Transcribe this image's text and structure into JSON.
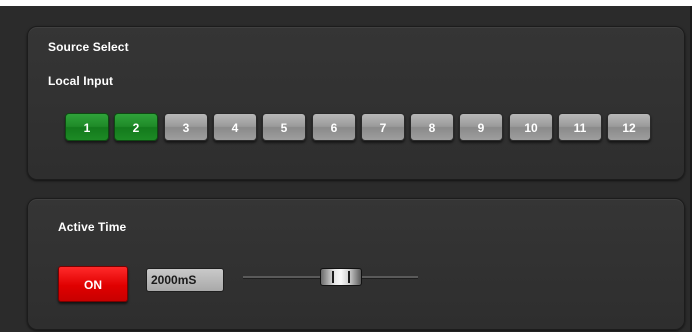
{
  "source_select": {
    "title": "Source Select",
    "local_input_label": "Local Input",
    "channels": [
      {
        "label": "1",
        "active": true
      },
      {
        "label": "2",
        "active": true
      },
      {
        "label": "3",
        "active": false
      },
      {
        "label": "4",
        "active": false
      },
      {
        "label": "5",
        "active": false
      },
      {
        "label": "6",
        "active": false
      },
      {
        "label": "7",
        "active": false
      },
      {
        "label": "8",
        "active": false
      },
      {
        "label": "9",
        "active": false
      },
      {
        "label": "10",
        "active": false
      },
      {
        "label": "11",
        "active": false
      },
      {
        "label": "12",
        "active": false
      }
    ]
  },
  "active_time": {
    "title": "Active Time",
    "toggle_label": "ON",
    "value": "2000mS",
    "slider_level": 0.58
  },
  "colors": {
    "channel_active": "#1f8a28",
    "channel_inactive": "#9a9a9a",
    "on_button": "#e00000",
    "panel_bg": "#2e2e2e"
  },
  "icons": {
    "slider_thumb": "slider-thumb-icon"
  }
}
